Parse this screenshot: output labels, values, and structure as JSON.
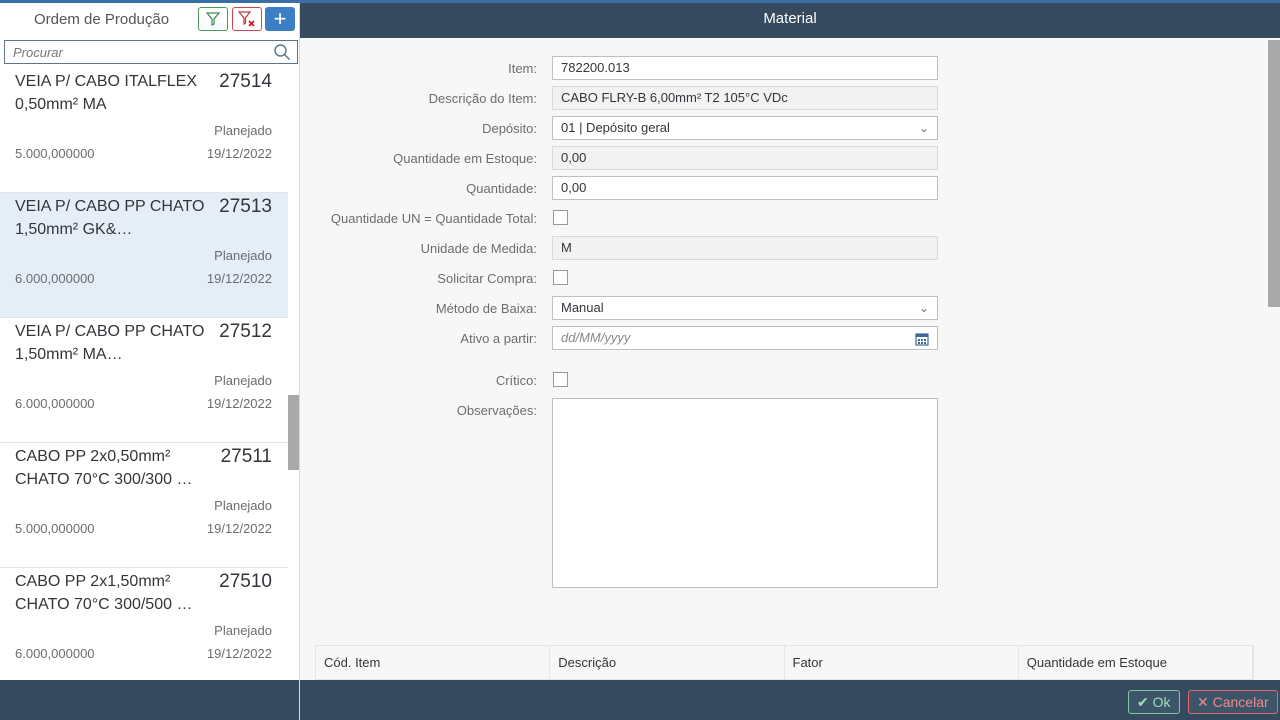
{
  "left": {
    "title": "Ordem de Produção",
    "search_placeholder": "Procurar",
    "items": [
      {
        "title": "VEIA P/ CABO ITALFLEX 0,50mm² MA",
        "number": "27514",
        "status": "Planejado",
        "quantity": "5.000,000000",
        "date": "19/12/2022"
      },
      {
        "title": "VEIA P/ CABO PP CHATO 1,50mm² GK&…",
        "number": "27513",
        "status": "Planejado",
        "quantity": "6.000,000000",
        "date": "19/12/2022"
      },
      {
        "title": "VEIA P/ CABO PP CHATO 1,50mm² MA…",
        "number": "27512",
        "status": "Planejado",
        "quantity": "6.000,000000",
        "date": "19/12/2022"
      },
      {
        "title": "CABO PP 2x0,50mm² CHATO 70°C 300/300 …",
        "number": "27511",
        "status": "Planejado",
        "quantity": "5.000,000000",
        "date": "19/12/2022"
      },
      {
        "title": "CABO PP 2x1,50mm² CHATO 70°C 300/500 …",
        "number": "27510",
        "status": "Planejado",
        "quantity": "6.000,000000",
        "date": "19/12/2022"
      }
    ]
  },
  "dialog": {
    "title": "Material",
    "fields": {
      "item": {
        "label": "Item:",
        "value": "782200.013"
      },
      "descricao": {
        "label": "Descrição do Item:",
        "value": "CABO FLRY-B 6,00mm²  T2 105°C VDc"
      },
      "deposito": {
        "label": "Depósito:",
        "value": "01 | Depósito geral"
      },
      "estoque": {
        "label": "Quantidade em Estoque:",
        "value": "0,00"
      },
      "quantidade": {
        "label": "Quantidade:",
        "value": "0,00"
      },
      "qtd_un": {
        "label": "Quantidade UN = Quantidade Total:",
        "checked": false
      },
      "unidade": {
        "label": "Unidade de Medida:",
        "value": "M"
      },
      "solicitar": {
        "label": "Solicitar Compra:",
        "checked": false
      },
      "metodo": {
        "label": "Método de Baixa:",
        "value": "Manual"
      },
      "ativo": {
        "label": "Ativo a partir:",
        "placeholder": "dd/MM/yyyy"
      },
      "critico": {
        "label": "Crítico:",
        "checked": false
      },
      "observacoes": {
        "label": "Observações:",
        "value": ""
      }
    },
    "table_columns": [
      "Cód. Item",
      "Descrição",
      "Fator",
      "Quantidade em Estoque"
    ],
    "ok_label": "Ok",
    "cancel_label": "Cancelar"
  },
  "colors": {
    "header": "#354a5f",
    "accent": "#3a6ea5",
    "selected": "#e5eef7",
    "ok": "#7fc79a",
    "cancel": "#e0686a"
  }
}
